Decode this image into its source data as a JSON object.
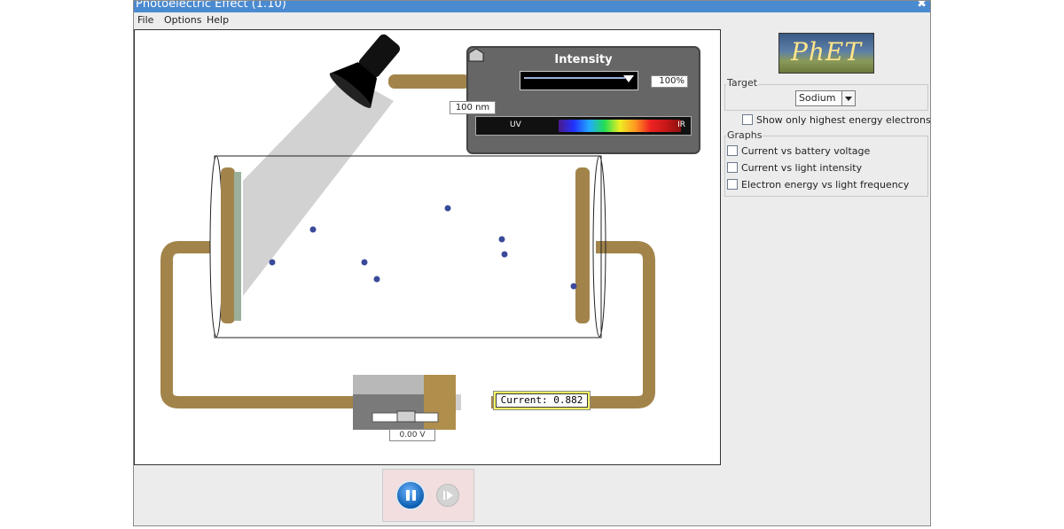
{
  "window": {
    "title": "Photoelectric Effect (1.10)",
    "close_glyph": "✖"
  },
  "menu": {
    "file": "File",
    "options": "Options",
    "help": "Help"
  },
  "sim": {
    "intensity_title": "Intensity",
    "intensity_value": "100%",
    "wavelength_value": "100 nm",
    "spectrum_uv": "UV",
    "spectrum_ir": "IR",
    "current_label": "Current:  0.882",
    "voltage_label": "0.00 V"
  },
  "controls": {
    "pause_icon": "pause-icon",
    "step_icon": "step-icon"
  },
  "panel": {
    "logo": "PhET",
    "target_label": "Target",
    "target_value": "Sodium",
    "highest_energy": "Show only highest energy electrons",
    "graphs_label": "Graphs",
    "graph1": "Current vs battery voltage",
    "graph2": "Current vs light intensity",
    "graph3": "Electron energy vs light frequency"
  },
  "colors": {
    "titlebar": "#4a8ad0",
    "wire": "#a2844a",
    "electron": "#3a4a9a",
    "highlight": "#ffff66"
  }
}
